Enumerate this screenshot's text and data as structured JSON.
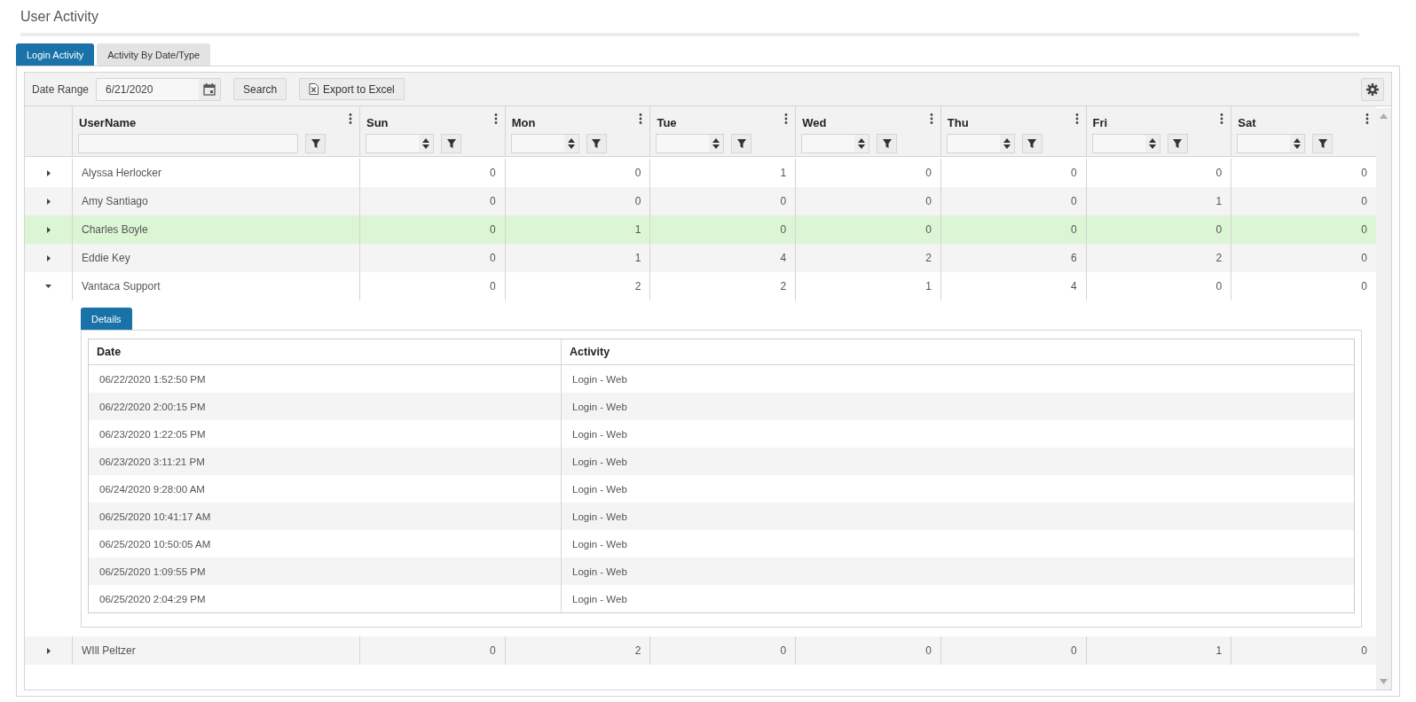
{
  "page": {
    "title": "User Activity"
  },
  "tabs": [
    {
      "label": "Login Activity",
      "selected": true
    },
    {
      "label": "Activity By Date/Type",
      "selected": false
    }
  ],
  "toolbar": {
    "date_range_label": "Date Range",
    "date_value": "6/21/2020",
    "search_button": "Search",
    "export_button": "Export to Excel"
  },
  "grid": {
    "columns": [
      {
        "label": "UserName",
        "kind": "text"
      },
      {
        "label": "Sun",
        "kind": "number"
      },
      {
        "label": "Mon",
        "kind": "number"
      },
      {
        "label": "Tue",
        "kind": "number"
      },
      {
        "label": "Wed",
        "kind": "number"
      },
      {
        "label": "Thu",
        "kind": "number"
      },
      {
        "label": "Fri",
        "kind": "number"
      },
      {
        "label": "Sat",
        "kind": "number"
      }
    ],
    "rows": [
      {
        "cells": [
          "Alyssa Herlocker",
          "0",
          "0",
          "1",
          "0",
          "0",
          "0",
          "0"
        ],
        "selected": false,
        "expanded": false
      },
      {
        "cells": [
          "Amy Santiago",
          "0",
          "0",
          "0",
          "0",
          "0",
          "1",
          "0"
        ],
        "selected": false,
        "expanded": false
      },
      {
        "cells": [
          "Charles Boyle",
          "0",
          "1",
          "0",
          "0",
          "0",
          "0",
          "0"
        ],
        "selected": true,
        "expanded": false
      },
      {
        "cells": [
          "Eddie Key",
          "0",
          "1",
          "4",
          "2",
          "6",
          "2",
          "0"
        ],
        "selected": false,
        "expanded": false
      },
      {
        "cells": [
          "Vantaca Support",
          "0",
          "2",
          "2",
          "1",
          "4",
          "0",
          "0"
        ],
        "selected": false,
        "expanded": true,
        "details": {
          "tab": {
            "label": "Details",
            "selected": true
          },
          "columns": [
            "Date",
            "Activity"
          ],
          "rows": [
            [
              "06/22/2020 1:52:50 PM",
              "Login - Web"
            ],
            [
              "06/22/2020 2:00:15 PM",
              "Login - Web"
            ],
            [
              "06/23/2020 1:22:05 PM",
              "Login - Web"
            ],
            [
              "06/23/2020 3:11:21 PM",
              "Login - Web"
            ],
            [
              "06/24/2020 9:28:00 AM",
              "Login - Web"
            ],
            [
              "06/25/2020 10:41:17 AM",
              "Login - Web"
            ],
            [
              "06/25/2020 10:50:05 AM",
              "Login - Web"
            ],
            [
              "06/25/2020 1:09:55 PM",
              "Login - Web"
            ],
            [
              "06/25/2020 2:04:29 PM",
              "Login - Web"
            ]
          ]
        }
      },
      {
        "cells": [
          "WIll Peltzer",
          "0",
          "2",
          "0",
          "0",
          "0",
          "1",
          "0"
        ],
        "selected": false,
        "expanded": false
      }
    ]
  }
}
